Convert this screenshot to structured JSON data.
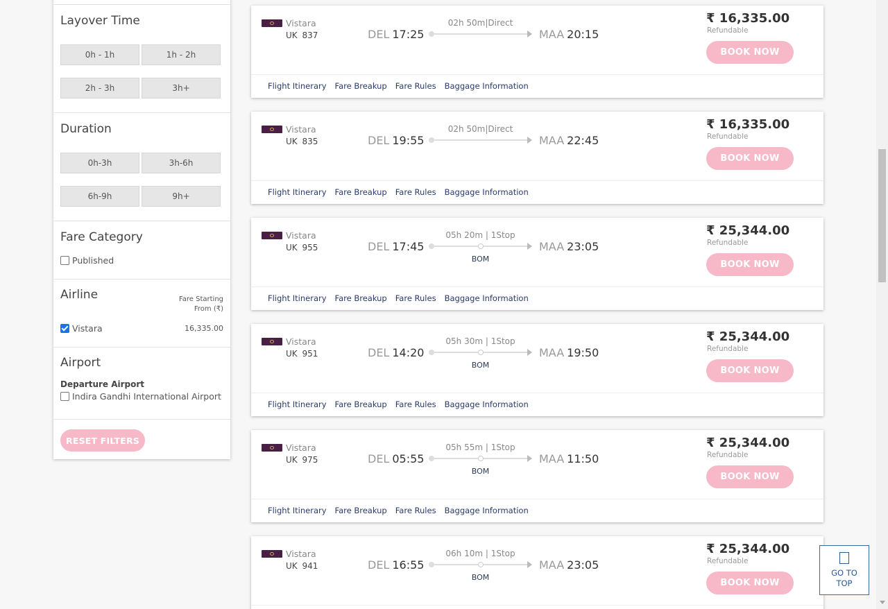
{
  "filters": {
    "layover": {
      "title": "Layover Time",
      "options": [
        "0h - 1h",
        "1h - 2h",
        "2h - 3h",
        "3h+"
      ]
    },
    "duration": {
      "title": "Duration",
      "options": [
        "0h-3h",
        "3h-6h",
        "6h-9h",
        "9h+"
      ]
    },
    "fare_category": {
      "title": "Fare Category",
      "option": "Published",
      "checked": false
    },
    "airline": {
      "title": "Airline",
      "fare_from": "Fare Starting From (₹)",
      "name": "Vistara",
      "fare": "16,335.00",
      "checked": true
    },
    "airport": {
      "title": "Airport",
      "departure_label": "Departure Airport",
      "option": "Indira Gandhi International Airport",
      "checked": false
    },
    "reset_label": "RESET FILTERS"
  },
  "flights": [
    {
      "airline": "Vistara",
      "flight_no": "UK  837",
      "dep_code": "DEL",
      "dep_time": "17:25",
      "arr_code": "MAA",
      "arr_time": "20:15",
      "duration": "02h 50m|Direct",
      "via": "",
      "price": "₹ 16,335.00",
      "refund": "Refundable"
    },
    {
      "airline": "Vistara",
      "flight_no": "UK  835",
      "dep_code": "DEL",
      "dep_time": "19:55",
      "arr_code": "MAA",
      "arr_time": "22:45",
      "duration": "02h 50m|Direct",
      "via": "",
      "price": "₹ 16,335.00",
      "refund": "Refundable"
    },
    {
      "airline": "Vistara",
      "flight_no": "UK  955",
      "dep_code": "DEL",
      "dep_time": "17:45",
      "arr_code": "MAA",
      "arr_time": "23:05",
      "duration": "05h 20m | 1Stop",
      "via": "BOM",
      "price": "₹ 25,344.00",
      "refund": "Refundable"
    },
    {
      "airline": "Vistara",
      "flight_no": "UK  951",
      "dep_code": "DEL",
      "dep_time": "14:20",
      "arr_code": "MAA",
      "arr_time": "19:50",
      "duration": "05h 30m | 1Stop",
      "via": "BOM",
      "price": "₹ 25,344.00",
      "refund": "Refundable"
    },
    {
      "airline": "Vistara",
      "flight_no": "UK  975",
      "dep_code": "DEL",
      "dep_time": "05:55",
      "arr_code": "MAA",
      "arr_time": "11:50",
      "duration": "05h 55m | 1Stop",
      "via": "BOM",
      "price": "₹ 25,344.00",
      "refund": "Refundable"
    },
    {
      "airline": "Vistara",
      "flight_no": "UK  941",
      "dep_code": "DEL",
      "dep_time": "16:55",
      "arr_code": "MAA",
      "arr_time": "23:05",
      "duration": "06h 10m | 1Stop",
      "via": "BOM",
      "price": "₹ 25,344.00",
      "refund": "Refundable"
    }
  ],
  "card_links": [
    "Flight Itinerary",
    "Fare Breakup",
    "Fare Rules",
    "Baggage Information"
  ],
  "book_label": "BOOK NOW",
  "gotop": {
    "line1": "GO TO",
    "line2": "TOP"
  }
}
